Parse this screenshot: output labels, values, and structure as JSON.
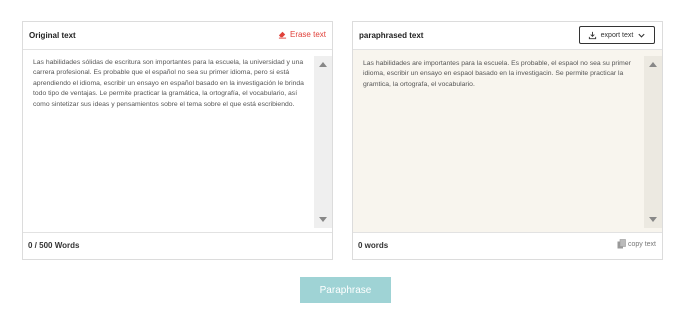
{
  "original": {
    "title": "Original text",
    "erase_label": "Erase text",
    "text": "Las habilidades sólidas de escritura son importantes para la escuela, la universidad y una carrera profesional. Es probable que el español no sea su primer idioma, pero si está aprendiendo el idioma, escribir un ensayo en español basado en la investigación le brinda todo tipo de ventajas. Le permite practicar la gramática, la ortografía, el vocabulario, así como sintetizar sus ideas y pensamientos sobre el tema sobre el que está escribiendo.",
    "word_count": "0 / 500 Words"
  },
  "paraphrased": {
    "title": "paraphrased text",
    "export_label": "export text",
    "text": "Las habilidades are importantes para la escuela. Es probable, el espaol no sea su primer idioma, escribir un ensayo en espaol basado en la investigacin. Se permite practicar la gramtica, la ortografa, el vocabulario.",
    "word_count": "0 words",
    "copy_label": "copy text"
  },
  "paraphrase_button": "Paraphrase",
  "colors": {
    "accent_button": "#9fd3d5",
    "erase": "#e0413a",
    "paraphrased_bg": "#f8f5ee"
  }
}
